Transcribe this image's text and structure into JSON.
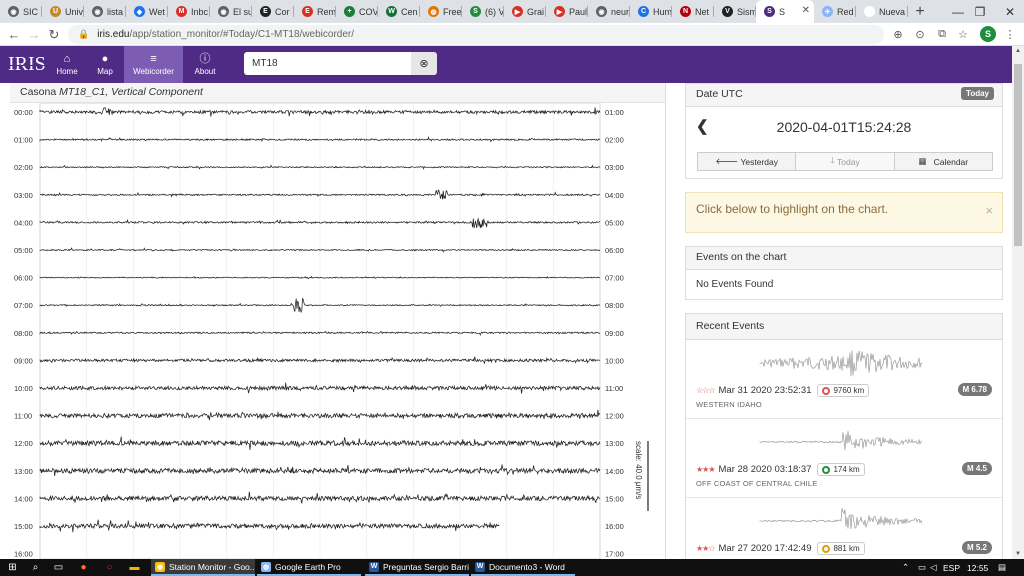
{
  "browser": {
    "tabs": [
      {
        "label": "SIC",
        "color": "#5f6368",
        "glyph": "◉"
      },
      {
        "label": "Univ",
        "color": "#c58b2a",
        "glyph": "U"
      },
      {
        "label": "lista",
        "color": "#5f6368",
        "glyph": "◉"
      },
      {
        "label": "Wet",
        "color": "#1a73e8",
        "glyph": "◆"
      },
      {
        "label": "Inbc",
        "color": "#d93025",
        "glyph": "M"
      },
      {
        "label": "El su",
        "color": "#5f6368",
        "glyph": "◉"
      },
      {
        "label": "Cor",
        "color": "#222222",
        "glyph": "E"
      },
      {
        "label": "Rem",
        "color": "#d93025",
        "glyph": "E"
      },
      {
        "label": "COV",
        "color": "#188038",
        "glyph": "+"
      },
      {
        "label": "Cen",
        "color": "#137333",
        "glyph": "W"
      },
      {
        "label": "Free",
        "color": "#e37400",
        "glyph": "◍"
      },
      {
        "label": "(6) V",
        "color": "#1e8e3e",
        "glyph": "S"
      },
      {
        "label": "Grai",
        "color": "#d93025",
        "glyph": "▶"
      },
      {
        "label": "Paul",
        "color": "#d93025",
        "glyph": "▶"
      },
      {
        "label": "neur",
        "color": "#5f6368",
        "glyph": "◉"
      },
      {
        "label": "Hum",
        "color": "#1a73e8",
        "glyph": "C"
      },
      {
        "label": "Net",
        "color": "#b3000c",
        "glyph": "N"
      },
      {
        "label": "Sism",
        "color": "#222222",
        "glyph": "V"
      },
      {
        "label": "S",
        "color": "#502b85",
        "glyph": "S",
        "active": true
      },
      {
        "label": "Red",
        "color": "#8ab4f8",
        "glyph": "✈"
      },
      {
        "label": "Nueva p",
        "color": "#ffffff",
        "glyph": ""
      }
    ],
    "url_main": "iris.edu",
    "url_rest": "/app/station_monitor/#Today/C1-MT18/webicorder/",
    "profile_initial": "S"
  },
  "nav": {
    "logo": "IRIS",
    "items": [
      {
        "label": "Home",
        "glyph": "⌂"
      },
      {
        "label": "Map",
        "glyph": "●"
      },
      {
        "label": "Webicorder",
        "glyph": "≡"
      },
      {
        "label": "About",
        "glyph": "ⓘ"
      }
    ],
    "station_query": "MT18",
    "accent": "#502b85",
    "active_bg": "#7d5db3"
  },
  "chart_header": {
    "station_name": "Casona",
    "station_code": "MT18_C1,",
    "component": "Vertical Component"
  },
  "chart_data": {
    "type": "line",
    "title": "Casona MT18_C1, Vertical Component",
    "rows_left": [
      "00:00",
      "01:00",
      "02:00",
      "03:00",
      "04:00",
      "05:00",
      "06:00",
      "07:00",
      "08:00",
      "09:00",
      "10:00",
      "11:00",
      "12:00",
      "13:00",
      "14:00",
      "15:00",
      "16:00"
    ],
    "rows_right": [
      "01:00",
      "02:00",
      "03:00",
      "04:00",
      "05:00",
      "06:00",
      "07:00",
      "08:00",
      "09:00",
      "10:00",
      "11:00",
      "12:00",
      "13:00",
      "14:00",
      "15:00",
      "16:00",
      "17:00"
    ],
    "noise_level": [
      0.6,
      0.3,
      0.25,
      0.3,
      0.35,
      0.25,
      0.2,
      0.25,
      0.3,
      0.55,
      0.75,
      0.9,
      1.0,
      1.0,
      0.95,
      0.9,
      0.3
    ],
    "trace_fraction_of_hour": [
      1,
      1,
      1,
      1,
      1,
      1,
      1,
      1,
      1,
      1,
      1,
      1,
      1,
      1,
      1,
      0.82,
      0
    ],
    "scale_label": "scale: 40.0 μm/s",
    "grid": true,
    "trace_color": "#222222"
  },
  "date_panel": {
    "header": "Date UTC",
    "badge": "Today",
    "datetime": "2020-04-01T15:24:28",
    "back_glyph": "❮",
    "buttons": {
      "yesterday": "Yesterday",
      "today": "Today",
      "calendar": "Calendar"
    }
  },
  "alert": {
    "text": "Click below to highlight on the chart.",
    "close": "×"
  },
  "events_on_chart": {
    "header": "Events on the chart",
    "empty_text": "No Events Found"
  },
  "recent_events": {
    "header": "Recent Events",
    "items": [
      {
        "stars": "☆☆☆",
        "datetime": "Mar 31 2020 23:52:31",
        "distance": "9760 km",
        "pin_color": "#d9534f",
        "region": "WESTERN IDAHO",
        "magnitude": "M 6.78"
      },
      {
        "stars": "★★★",
        "datetime": "Mar 28 2020 03:18:37",
        "distance": "174 km",
        "pin_color": "#1e8e3e",
        "region": "OFF COAST OF CENTRAL CHILE",
        "magnitude": "M 4.5"
      },
      {
        "stars": "★★☆",
        "datetime": "Mar 27 2020 17:42:49",
        "distance": "881 km",
        "pin_color": "#e0a000",
        "region": "",
        "magnitude": "M 5.2"
      }
    ]
  },
  "taskbar": {
    "apps": [
      {
        "label": "Station Monitor - Goo...",
        "color": "#fbbc04",
        "glyph": "◉",
        "active": true
      },
      {
        "label": "Google Earth Pro",
        "color": "#8ab4f8",
        "glyph": "◍"
      },
      {
        "label": "Preguntas Sergio Barri...",
        "color": "#2b579a",
        "glyph": "W"
      },
      {
        "label": "Documento3 - Word",
        "color": "#2b579a",
        "glyph": "W"
      }
    ],
    "language": "ESP",
    "clock": "12:55"
  }
}
